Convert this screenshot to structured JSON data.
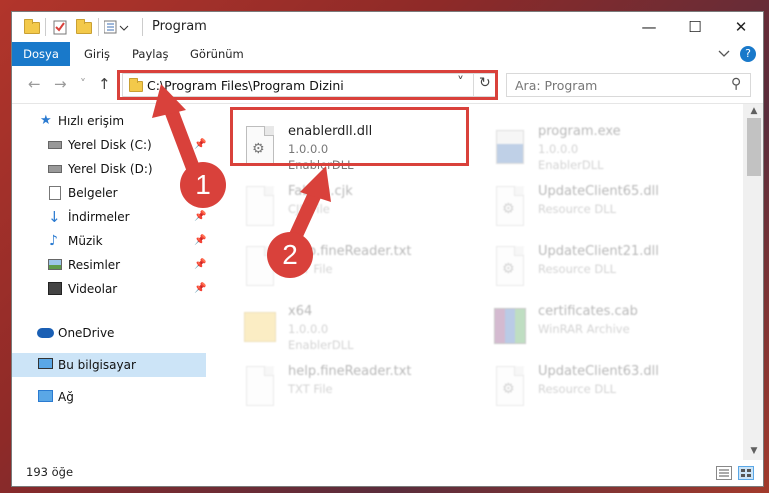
{
  "window": {
    "title": "Program",
    "controls": {
      "minimize": "—",
      "maximize": "☐",
      "close": "✕"
    }
  },
  "ribbon": {
    "tabs": [
      {
        "label": "Dosya",
        "active": true
      },
      {
        "label": "Giriş"
      },
      {
        "label": "Paylaş"
      },
      {
        "label": "Görünüm"
      }
    ],
    "collapse_icon": "chevron-down-icon",
    "help_icon": "help-icon",
    "help_label": "?"
  },
  "nav": {
    "back": "←",
    "forward": "→",
    "recent": "˅",
    "up": "↑",
    "address": "C:\\Program Files\\Program Dizini",
    "address_dropdown": "˅",
    "refresh": "↻",
    "search_placeholder": "Ara: Program",
    "search_icon": "⚲"
  },
  "sidebar": {
    "items": [
      {
        "label": "Hızlı erişim",
        "icon": "star-icon",
        "level": 0
      },
      {
        "label": "Yerel Disk (C:)",
        "icon": "drive-icon",
        "pinned": true
      },
      {
        "label": "Yerel Disk (D:)",
        "icon": "drive-icon",
        "pinned": false
      },
      {
        "label": "Belgeler",
        "icon": "documents-icon",
        "pinned": true
      },
      {
        "label": "İndirmeler",
        "icon": "download-icon",
        "pinned": true
      },
      {
        "label": "Müzik",
        "icon": "music-icon",
        "pinned": true
      },
      {
        "label": "Resimler",
        "icon": "pictures-icon",
        "pinned": true
      },
      {
        "label": "Videolar",
        "icon": "videos-icon",
        "pinned": true
      },
      {
        "label": "OneDrive",
        "icon": "cloud-icon",
        "level": 0
      },
      {
        "label": "Bu bilgisayar",
        "icon": "computer-icon",
        "level": 0,
        "selected": true
      },
      {
        "label": "Ağ",
        "icon": "network-icon",
        "level": 0
      }
    ],
    "pin_glyph": "📌"
  },
  "files": {
    "left": [
      {
        "name": "enablerdll.dll",
        "line1": "1.0.0.0",
        "line2": "EnablerDLL",
        "icon": "dll-icon",
        "highlighted": true
      },
      {
        "name": "Fabula.cjk",
        "line1": "CJK File",
        "line2": "",
        "icon": "file-icon"
      },
      {
        "name": "help.fineReader.txt",
        "line1": "TXT File",
        "line2": "",
        "icon": "file-icon"
      },
      {
        "name": "x64",
        "line1": "1.0.0.0",
        "line2": "EnablerDLL",
        "icon": "folder-icon"
      },
      {
        "name": "help.fineReader.txt",
        "line1": "TXT File",
        "line2": "",
        "icon": "file-icon"
      }
    ],
    "right": [
      {
        "name": "program.exe",
        "line1": "1.0.0.0",
        "line2": "EnablerDLL",
        "icon": "exe-icon"
      },
      {
        "name": "UpdateClient65.dll",
        "line1": "Resource DLL",
        "line2": "",
        "icon": "dll-icon"
      },
      {
        "name": "UpdateClient21.dll",
        "line1": "Resource DLL",
        "line2": "",
        "icon": "dll-icon"
      },
      {
        "name": "certificates.cab",
        "line1": "WinRAR Archive",
        "line2": "",
        "icon": "archive-icon"
      },
      {
        "name": "UpdateClient63.dll",
        "line1": "Resource DLL",
        "line2": "",
        "icon": "dll-icon"
      }
    ]
  },
  "status": {
    "item_count": "193 öğe"
  },
  "annotations": {
    "step1": "1",
    "step2": "2",
    "accent": "#d9413b"
  }
}
